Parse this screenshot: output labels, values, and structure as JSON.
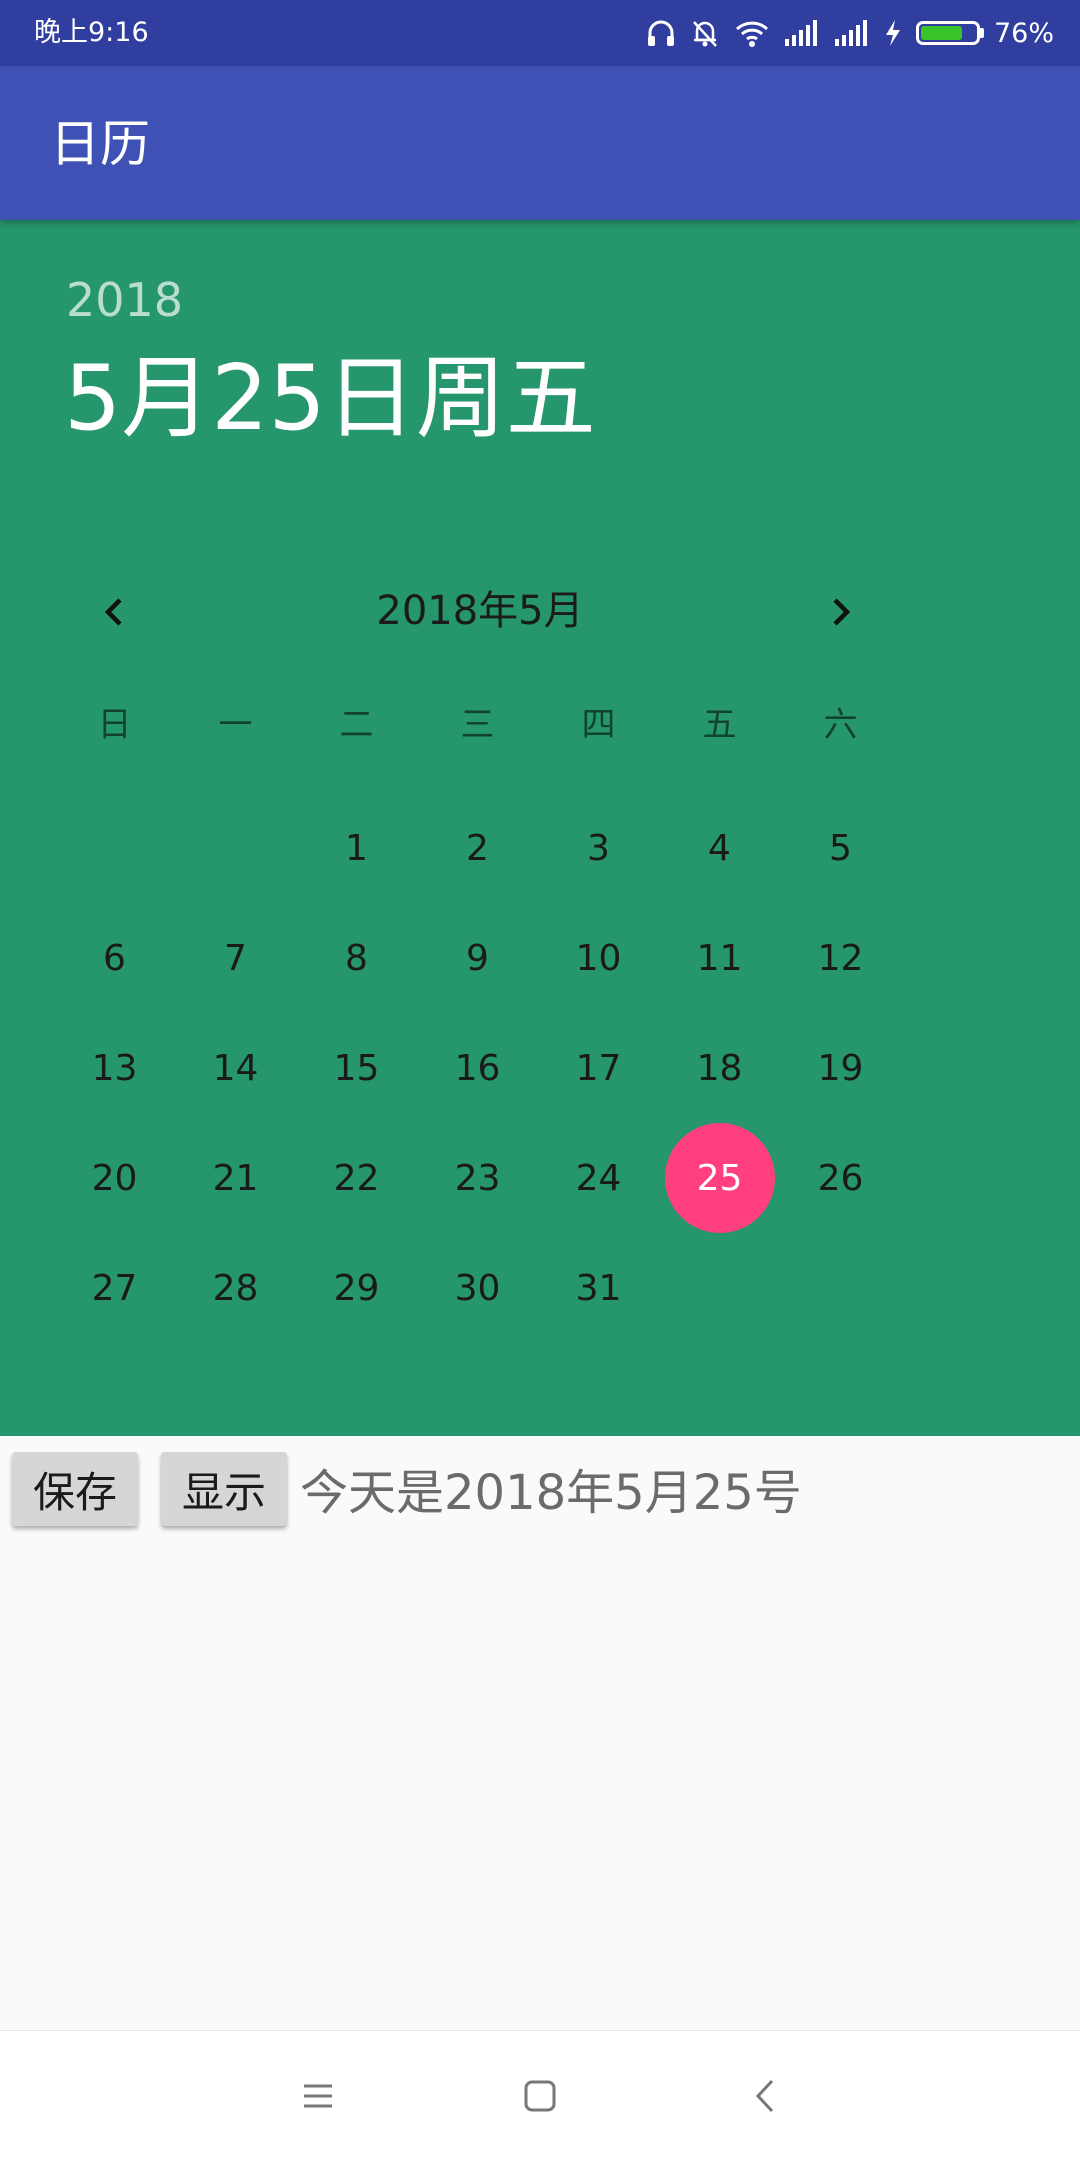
{
  "status_bar": {
    "time": "晚上9:16",
    "battery_percent": "76%",
    "battery_level": 0.76,
    "battery_color": "#39c52a",
    "icons": [
      "headset-icon",
      "mute-bell-icon",
      "wifi-icon",
      "signal-icon",
      "signal-icon",
      "charging-bolt-icon",
      "battery-icon"
    ]
  },
  "app_bar": {
    "title": "日历",
    "color": "#3f51b5"
  },
  "calendar": {
    "panel_color": "#26966c",
    "year": "2018",
    "selected_date": "5月25日周五",
    "month_label": "2018年5月",
    "prev_icon": "chevron-left-icon",
    "next_icon": "chevron-right-icon",
    "weekdays": [
      "日",
      "一",
      "二",
      "三",
      "四",
      "五",
      "六"
    ],
    "days": [
      "",
      "",
      "1",
      "2",
      "3",
      "4",
      "5",
      "6",
      "7",
      "8",
      "9",
      "10",
      "11",
      "12",
      "13",
      "14",
      "15",
      "16",
      "17",
      "18",
      "19",
      "20",
      "21",
      "22",
      "23",
      "24",
      "25",
      "26",
      "27",
      "28",
      "29",
      "30",
      "31",
      "",
      ""
    ],
    "selected_day": "25",
    "selected_color": "#ff3f7f"
  },
  "actions": {
    "save_label": "保存",
    "show_label": "显示",
    "today_text": "今天是2018年5月25号"
  },
  "nav_bar": {
    "icons": [
      "menu-icon",
      "home-icon",
      "back-icon"
    ]
  }
}
